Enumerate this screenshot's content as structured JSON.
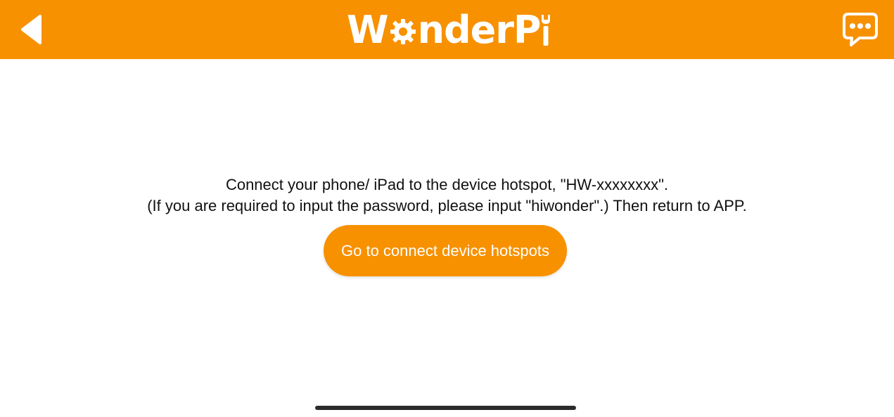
{
  "colors": {
    "brand": "#f79100",
    "background": "#ffffff",
    "text": "#111111",
    "on_brand": "#ffffff"
  },
  "header": {
    "logo_text_part1": "W",
    "logo_text_part2": "nderP",
    "back_icon": "triangle-left-icon",
    "chat_icon": "chat-bubble-ellipsis-icon"
  },
  "main": {
    "instruction_line1": "Connect your phone/ iPad to the device hotspot, \"HW-xxxxxxxx\".",
    "instruction_line2": "(If you are required to input the password, please input \"hiwonder\".) Then return to APP.",
    "connect_button_label": "Go to connect device hotspots"
  }
}
